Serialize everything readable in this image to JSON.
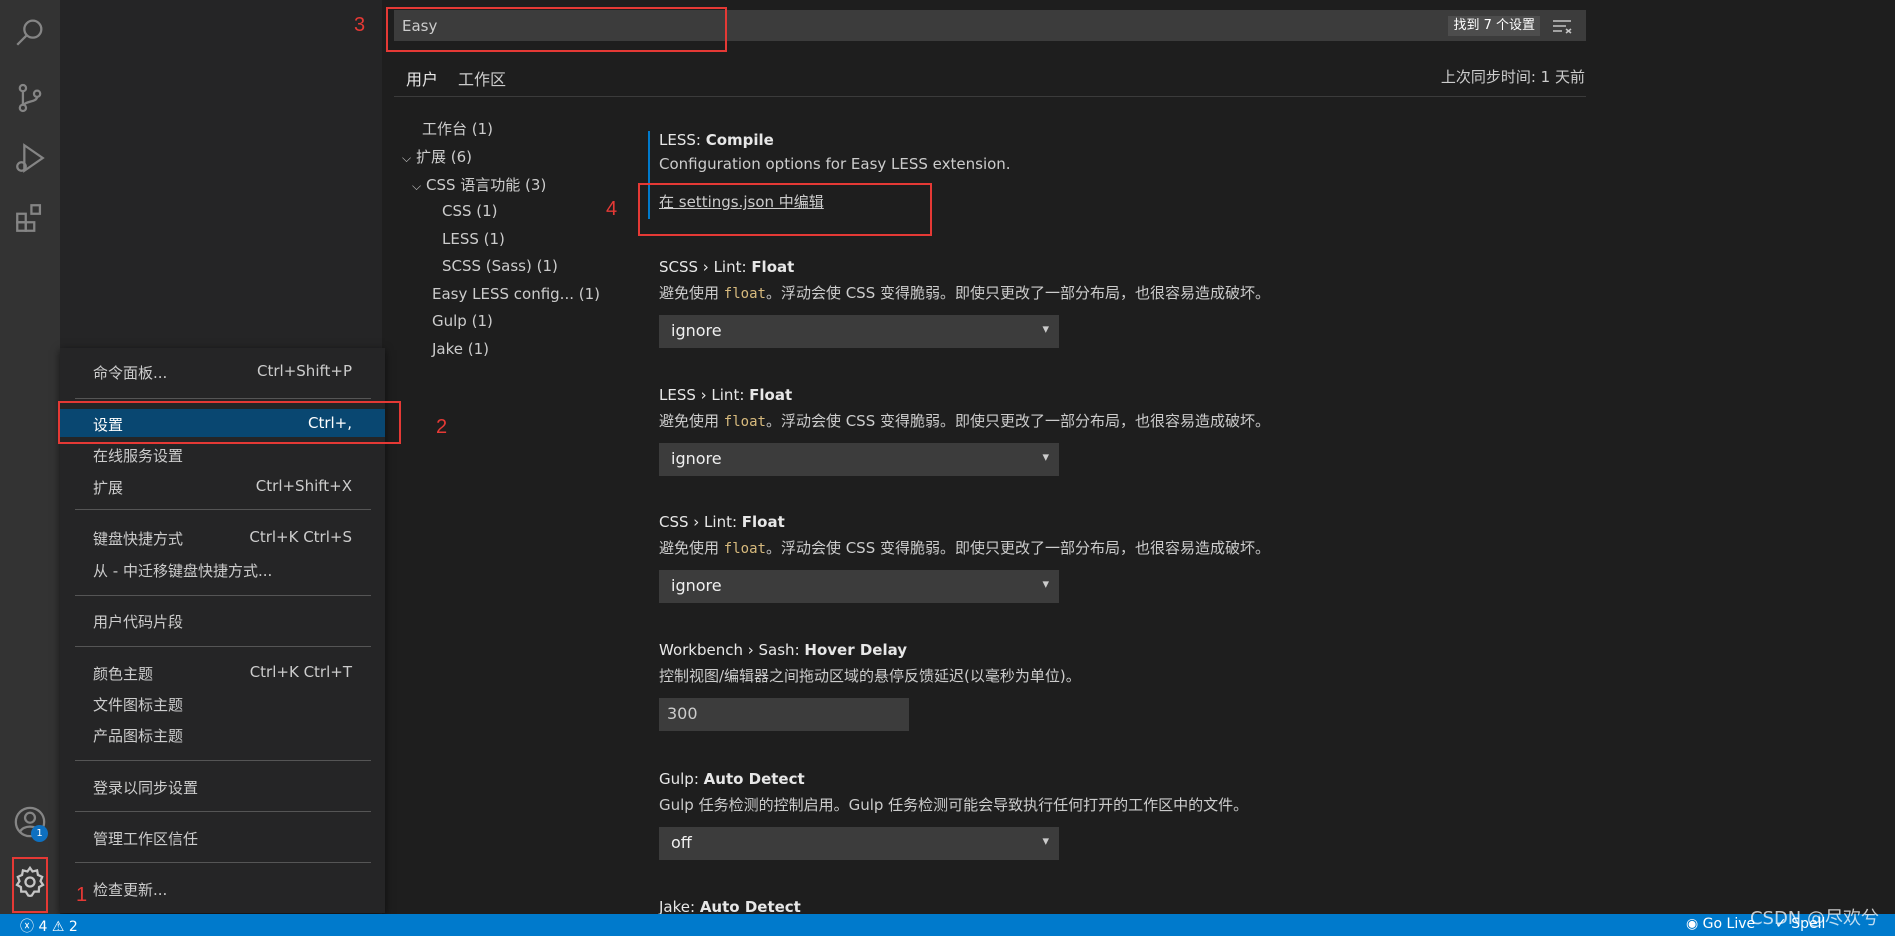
{
  "search": {
    "value": "Easy",
    "found": "找到 7 个设置"
  },
  "tabs": [
    {
      "label": "用户"
    },
    {
      "label": "工作区"
    }
  ],
  "sync": "上次同步时间: 1 天前",
  "tree": [
    {
      "label": "工作台 (1)"
    },
    {
      "label": "扩展 (6)"
    },
    {
      "label": "CSS 语言功能 (3)"
    },
    {
      "label": "CSS (1)"
    },
    {
      "label": "LESS (1)"
    },
    {
      "label": "SCSS (Sass) (1)"
    },
    {
      "label": "Easy LESS config... (1)"
    },
    {
      "label": "Gulp (1)"
    },
    {
      "label": "Jake (1)"
    }
  ],
  "settings": [
    {
      "prefix": "LESS: ",
      "name": "Compile",
      "desc": "Configuration options for Easy LESS extension.",
      "link": "在 settings.json 中编辑"
    },
    {
      "prefix": "SCSS › Lint: ",
      "name": "Float",
      "desc_a": "避免使用 ",
      "code": "float",
      "desc_b": "。浮动会使 CSS 变得脆弱。即使只更改了一部分布局，也很容易造成破坏。",
      "value": "ignore"
    },
    {
      "prefix": "LESS › Lint: ",
      "name": "Float",
      "desc_a": "避免使用 ",
      "code": "float",
      "desc_b": "。浮动会使 CSS 变得脆弱。即使只更改了一部分布局，也很容易造成破坏。",
      "value": "ignore"
    },
    {
      "prefix": "CSS › Lint: ",
      "name": "Float",
      "desc_a": "避免使用 ",
      "code": "float",
      "desc_b": "。浮动会使 CSS 变得脆弱。即使只更改了一部分布局，也很容易造成破坏。",
      "value": "ignore"
    },
    {
      "prefix": "Workbench › Sash: ",
      "name": "Hover Delay",
      "desc": "控制视图/编辑器之间拖动区域的悬停反馈延迟(以毫秒为单位)。",
      "value": "300"
    },
    {
      "prefix": "Gulp: ",
      "name": "Auto Detect",
      "desc": "Gulp 任务检测的控制启用。Gulp 任务检测可能会导致执行任何打开的工作区中的文件。",
      "value": "off"
    },
    {
      "prefix": "Jake: ",
      "name": "Auto Detect"
    }
  ],
  "menu": [
    {
      "label": "命令面板...",
      "key": "Ctrl+Shift+P"
    },
    {
      "label": "设置",
      "key": "Ctrl+,"
    },
    {
      "label": "在线服务设置",
      "key": ""
    },
    {
      "label": "扩展",
      "key": "Ctrl+Shift+X"
    },
    {
      "label": "键盘快捷方式",
      "key": "Ctrl+K Ctrl+S"
    },
    {
      "label": "从 - 中迁移键盘快捷方式...",
      "key": ""
    },
    {
      "label": "用户代码片段",
      "key": ""
    },
    {
      "label": "颜色主题",
      "key": "Ctrl+K Ctrl+T"
    },
    {
      "label": "文件图标主题",
      "key": ""
    },
    {
      "label": "产品图标主题",
      "key": ""
    },
    {
      "label": "登录以同步设置",
      "key": ""
    },
    {
      "label": "管理工作区信任",
      "key": ""
    },
    {
      "label": "检查更新...",
      "key": ""
    }
  ],
  "annotations": [
    "1",
    "2",
    "3",
    "4"
  ],
  "accounts_badge": "1",
  "status": {
    "errors": "4",
    "warnings": "2",
    "go_live": "Go Live",
    "spell": "Spell"
  },
  "watermark": "CSDN @尽欢兮",
  "colors": {
    "accent": "#007acc",
    "selection": "#094771",
    "annotation": "#e53935"
  }
}
